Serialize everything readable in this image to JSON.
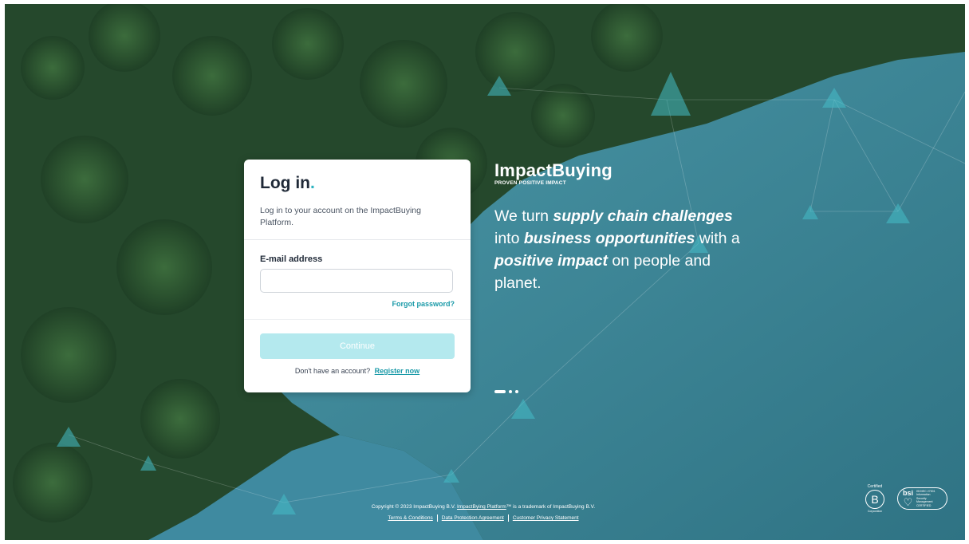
{
  "login": {
    "title": "Log in",
    "title_dot": ".",
    "subtitle": "Log in to your account on the ImpactBuying Platform.",
    "email_label": "E-mail address",
    "email_value": "",
    "forgot_password": "Forgot password?",
    "continue_button": "Continue",
    "no_account_text": "Don't have an account?",
    "register_link": "Register now"
  },
  "brand": {
    "logo": "ImpactBuying",
    "tagline": "PROVEN POSITIVE IMPACT"
  },
  "hero": {
    "headline_parts": [
      {
        "text": "We turn ",
        "bold": false
      },
      {
        "text": "supply chain challenges",
        "bold": true
      },
      {
        "text": " into ",
        "bold": false
      },
      {
        "text": "business opportunities",
        "bold": true
      },
      {
        "text": " with a ",
        "bold": false
      },
      {
        "text": "positive impact",
        "bold": true
      },
      {
        "text": " on people and planet.",
        "bold": false
      }
    ],
    "carousel_active_index": 0,
    "carousel_count": 3
  },
  "footer": {
    "copyright_prefix": "Copyright © 2023 ImpactBuying B.V. ",
    "platform_link": "ImpactBying Platform",
    "copyright_suffix": "™ is a trademark of ImpactBuying B.V.",
    "links": [
      "Terms & Conditions",
      "Data Protection Agreement",
      "Customer Privacy Statement"
    ]
  },
  "badges": {
    "bcorp_top": "Certified",
    "bcorp_letter": "B",
    "bcorp_bottom": "Corporation",
    "bsi_name": "bsi",
    "bsi_text": "ISO/IEC 27001 Information Security Management CERTIFIED"
  },
  "colors": {
    "accent": "#2bb3c0",
    "link": "#1a9aa8",
    "button_disabled": "#b4e9ee"
  }
}
